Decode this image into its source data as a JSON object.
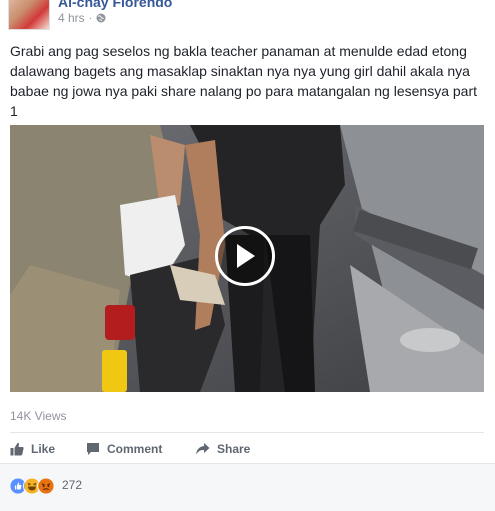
{
  "post": {
    "author": "Al-chay Florendo",
    "time": "4 hrs",
    "caption": "Grabi ang pag seselos ng bakla teacher panaman at menulde edad etong dalawang bagets ang masaklap sinaktan nya nya yung girl dahil akala nya babae ng jowa nya paki share nalang po para matangalan ng lesensya part 1",
    "views": "14K Views"
  },
  "actions": {
    "like": "Like",
    "comment": "Comment",
    "share": "Share"
  },
  "reactions": {
    "icons": [
      "like-icon",
      "haha-icon",
      "angry-icon"
    ],
    "count": "272"
  },
  "colors": {
    "link": "#365899",
    "like_blue": "#5890ff",
    "haha_yellow": "#f7b125",
    "angry_red": "#e9710f"
  }
}
